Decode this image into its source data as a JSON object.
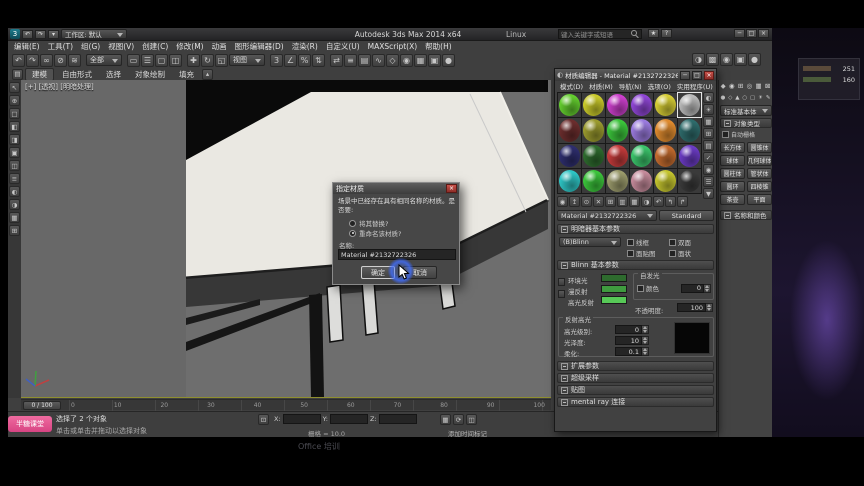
{
  "window": {
    "logo_glyph": "3",
    "workspace_label": "工作区: 默认",
    "title": "Autodesk 3ds Max 2014 x64",
    "title_suffix": "Linux",
    "search_placeholder": "键入关键字或短语",
    "quick_access_icons": [
      "↶",
      "↷",
      "▾"
    ],
    "infocenter_icons": [
      "★",
      "?"
    ],
    "window_buttons": [
      "─",
      "□",
      "×"
    ]
  },
  "menu_bar": {
    "items": [
      "编辑(E)",
      "工具(T)",
      "组(G)",
      "视图(V)",
      "创建(C)",
      "修改(M)",
      "动画",
      "图形编辑器(D)",
      "渲染(R)",
      "自定义(U)",
      "MAXScript(X)",
      "帮助(H)"
    ]
  },
  "main_toolbar": {
    "icons_a": [
      "↶",
      "↷",
      "∞",
      "⊘",
      "≋"
    ],
    "selection_filter": "全部",
    "icons_b": [
      "▭",
      "☰",
      "▢",
      "◫"
    ],
    "icons_c": [
      "✚",
      "↻",
      "◱"
    ],
    "ref_coord": "视图",
    "icons_d": [
      "3",
      "∠",
      "%",
      "⇅"
    ],
    "icons_e": [
      "⇄",
      "≡",
      "▤",
      "∿",
      "◇",
      "◉",
      "▦",
      "▣",
      "●"
    ],
    "icons_f": [
      "◑",
      "▩",
      "◉",
      "▣",
      "●"
    ]
  },
  "ribbon": {
    "menu_icon": "▤",
    "min_icon": "▴",
    "tabs": [
      "建模",
      "自由形式",
      "选择",
      "对象绘制",
      "填充"
    ]
  },
  "left_toolbar": {
    "icons": [
      "↖",
      "⊕",
      "□",
      "◧",
      "◨",
      "▣",
      "◫",
      "≡",
      "◐",
      "◑",
      "▦",
      "⊞"
    ]
  },
  "viewport": {
    "label": "[+] [透视] [明暗处理]"
  },
  "dialog": {
    "title": "指定材质",
    "close": "×",
    "message": "场景中已经存在具有相同名称的材质。是否要:",
    "options": [
      "将其替换?",
      "重命名该材质?"
    ],
    "name_label": "名称:",
    "name_value": "Material #2132722326",
    "ok": "确定",
    "cancel": "取消"
  },
  "material_editor": {
    "icon_glyph": "◐",
    "title": "材质编辑器 - Material #2132722326",
    "window_buttons": [
      "─",
      "□",
      "×"
    ],
    "menus": [
      "模式(D)",
      "材质(M)",
      "导航(N)",
      "选项(O)",
      "实用程序(U)"
    ],
    "palette": [
      "#63cc2e",
      "#c9c92a",
      "#cc3fcc",
      "#8f46d4",
      "#d4cb34",
      "#b9b9b9",
      "#6b2d2d",
      "#9a9a2e",
      "#3bc43b",
      "#9a7ade",
      "#de8a2e",
      "#2e6b6b",
      "#2e2e6e",
      "#2e6b2e",
      "#c43b3b",
      "#3bc46b",
      "#c46b2e",
      "#6b3bc4",
      "#2ec4c4",
      "#3bc43b",
      "#9a9a6b",
      "#c48a9a",
      "#c4c42e",
      "#3a3a3a"
    ],
    "sample_tools": [
      "◐",
      "☀",
      "▦",
      "⊞",
      "▤",
      "✓",
      "◉",
      "☰",
      "▼"
    ],
    "tool_row": [
      "◉",
      "↥",
      "⊙",
      "✕",
      "⊞",
      "▥",
      "▦",
      "◑",
      "↶",
      "↰",
      "↱"
    ],
    "material_name": "Material #2132722326",
    "material_type": "Standard",
    "shader_rollout": {
      "header": "明暗器基本参数",
      "shader_type": "(B)Blinn",
      "wire": "线框",
      "two_sided": "双面",
      "face_map": "面贴图",
      "faceted": "面状"
    },
    "blinn_rollout": {
      "header": "Blinn 基本参数",
      "ambient": "环境光",
      "diffuse": "漫反射",
      "specular": "高光反射",
      "ambient_color": "#2e6b2e",
      "diffuse_color": "#3f9b3f",
      "specular_color": "#57c957",
      "self_illum": "自发光",
      "color_cb": "颜色",
      "self_illum_value": "0",
      "opacity_label": "不透明度:",
      "opacity_value": "100",
      "spec_group": "反射高光",
      "spec_level_label": "高光级别:",
      "spec_level_value": "0",
      "gloss_label": "光泽度:",
      "gloss_value": "10",
      "soften_label": "柔化:",
      "soften_value": "0.1"
    },
    "extra_rollouts": [
      "扩展参数",
      "超级采样",
      "贴图",
      "mental ray 连接"
    ]
  },
  "command_panel": {
    "tab_icons": [
      "◆",
      "◉",
      "⊞",
      "◎",
      "▦",
      "⊠"
    ],
    "sub_icons": [
      "●",
      "◇",
      "▲",
      "○",
      "▢",
      "☀",
      "✎"
    ],
    "category_dropdown": "标准基本体",
    "object_type_header": "对象类型",
    "autogrid_label": "自动栅格",
    "buttons": [
      "长方体",
      "圆锥体",
      "球体",
      "几何球体",
      "圆柱体",
      "管状体",
      "圆环",
      "四棱锥",
      "茶壶",
      "平面"
    ],
    "name_color_header": "名称和颜色"
  },
  "timeline": {
    "slider_value": "0 / 100",
    "ticks": [
      "0",
      "10",
      "20",
      "30",
      "40",
      "50",
      "60",
      "70",
      "80",
      "90",
      "100"
    ]
  },
  "status_bar": {
    "selection_text": "选择了 2 个对象",
    "prompt_text": "单击或单击并拖动以选择对象",
    "lock_glyph": "⊡",
    "coord_labels": [
      "X:",
      "Y:",
      "Z:"
    ],
    "grid_text": "栅格 = 10.0",
    "add_time_tag": "添加时间标记",
    "right_icons": [
      "▦",
      "⟳",
      "◫"
    ]
  },
  "watermark": {
    "badge": "半糖课堂",
    "faint_text": "Office 培训"
  },
  "right_strip": {
    "values": [
      "251",
      "160"
    ]
  }
}
